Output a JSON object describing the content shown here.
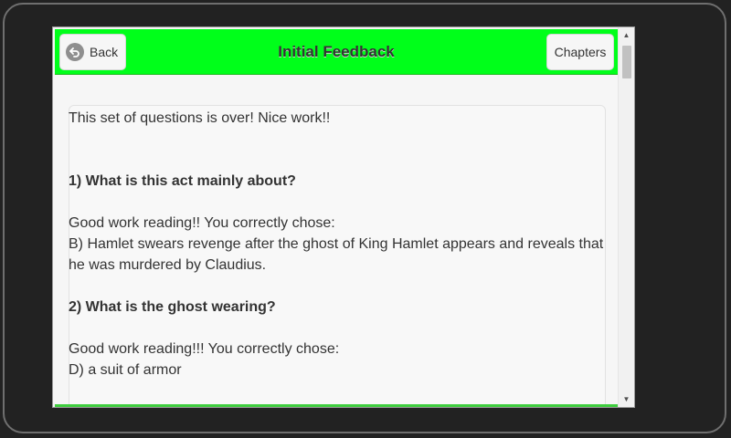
{
  "header": {
    "back_label": "Back",
    "title": "Initial Feedback",
    "chapters_label": "Chapters"
  },
  "content": {
    "intro": "This set of questions is over! Nice work!!",
    "items": [
      {
        "question": "1) What is this act mainly about?",
        "feedback": "Good work reading!! You correctly chose:",
        "answer": "B) Hamlet swears revenge after the ghost of King Hamlet appears and reveals that he was murdered by Claudius."
      },
      {
        "question": "2) What is the ghost wearing?",
        "feedback": "Good work reading!!! You correctly chose:",
        "answer": "D) a suit of armor"
      }
    ]
  },
  "colors": {
    "header_bg": "#00ff1a",
    "page_bg": "#f6f6f6",
    "device_bg": "#222222",
    "text": "#333333"
  },
  "icons": {
    "back": "back-arrow-circle-icon",
    "scroll_up": "scroll-up-arrow-icon",
    "scroll_down": "scroll-down-arrow-icon"
  }
}
